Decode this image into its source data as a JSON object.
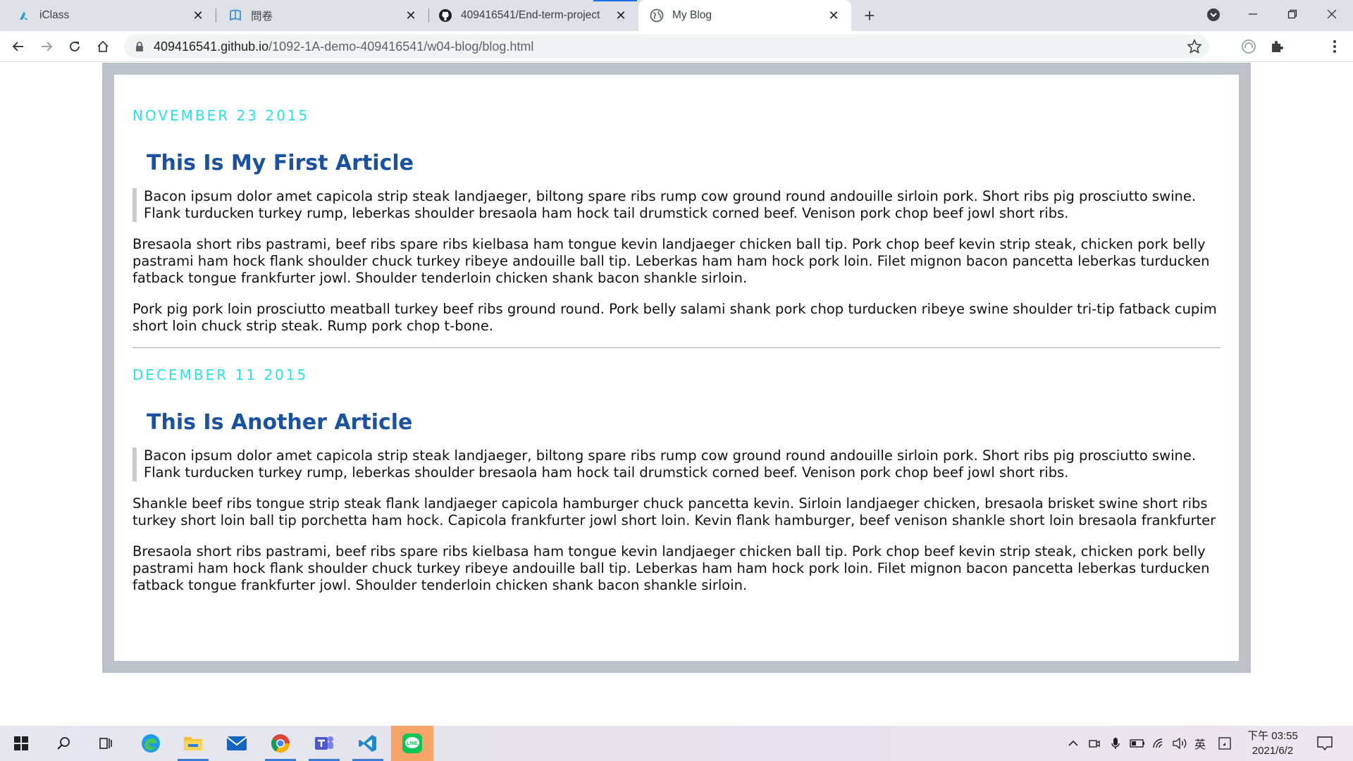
{
  "browser": {
    "tabs": [
      {
        "title": "iClass",
        "icon": "iclass-icon"
      },
      {
        "title": "問卷",
        "icon": "survey-icon"
      },
      {
        "title": "409416541/End-term-project",
        "icon": "github-icon"
      },
      {
        "title": "My Blog",
        "icon": "globe-icon",
        "active": true
      }
    ],
    "url_host": "409416541.github.io",
    "url_path": "/1092-1A-demo-409416541/w04-blog/blog.html"
  },
  "blog": {
    "articles": [
      {
        "date": "November 23 2015",
        "title": "This Is My First Article",
        "quote": "Bacon ipsum dolor amet capicola strip steak landjaeger, biltong spare ribs rump cow ground round andouille sirloin pork. Short ribs pig prosciutto swine. Flank turducken turkey rump, leberkas shoulder bresaola ham hock tail drumstick corned beef. Venison pork chop beef jowl short ribs.",
        "paragraphs": [
          "Bresaola short ribs pastrami, beef ribs spare ribs kielbasa ham tongue kevin landjaeger chicken ball tip. Pork chop beef kevin strip steak, chicken pork belly pastrami ham hock flank shoulder chuck turkey ribeye andouille ball tip. Leberkas ham ham hock pork loin. Filet mignon bacon pancetta leberkas turducken fatback tongue frankfurter jowl. Shoulder tenderloin chicken shank bacon shankle sirloin.",
          "Pork pig pork loin prosciutto meatball turkey beef ribs ground round. Pork belly salami shank pork chop turducken ribeye swine shoulder tri-tip fatback cupim short loin chuck strip steak. Rump pork chop t-bone."
        ]
      },
      {
        "date": "December 11 2015",
        "title": "This Is Another Article",
        "quote": "Bacon ipsum dolor amet capicola strip steak landjaeger, biltong spare ribs rump cow ground round andouille sirloin pork. Short ribs pig prosciutto swine. Flank turducken turkey rump, leberkas shoulder bresaola ham hock tail drumstick corned beef. Venison pork chop beef jowl short ribs.",
        "paragraphs": [
          "Shankle beef ribs tongue strip steak flank landjaeger capicola hamburger chuck pancetta kevin. Sirloin landjaeger chicken, bresaola brisket swine short ribs turkey short loin ball tip porchetta ham hock. Capicola frankfurter jowl short loin. Kevin flank hamburger, beef venison shankle short loin bresaola frankfurter",
          "Bresaola short ribs pastrami, beef ribs spare ribs kielbasa ham tongue kevin landjaeger chicken ball tip. Pork chop beef kevin strip steak, chicken pork belly pastrami ham hock flank shoulder chuck turkey ribeye andouille ball tip. Leberkas ham ham hock pork loin. Filet mignon bacon pancetta leberkas turducken fatback tongue frankfurter jowl. Shoulder tenderloin chicken shank bacon shankle sirloin."
        ]
      }
    ]
  },
  "taskbar": {
    "apps": [
      "windows-start-icon",
      "search-icon",
      "task-view-icon",
      "edge-icon",
      "file-explorer-icon",
      "mail-icon",
      "chrome-icon",
      "teams-icon",
      "vscode-icon",
      "line-icon"
    ],
    "ime": "英",
    "clock_time": "下午 03:55",
    "clock_date": "2021/6/2"
  },
  "colors": {
    "date": "#2be0e6",
    "title": "#1a52a0",
    "frame": "#bcc2c7"
  }
}
